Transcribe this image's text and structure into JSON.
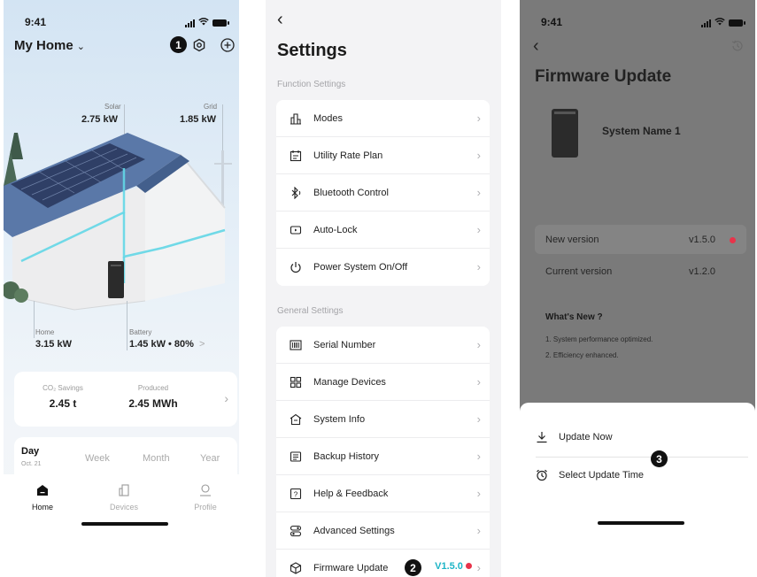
{
  "status_time": "9:41",
  "home": {
    "title": "My Home",
    "badge": "1",
    "solar": {
      "label": "Solar",
      "value": "2.75 kW"
    },
    "grid": {
      "label": "Grid",
      "value": "1.85 kW"
    },
    "home_power": {
      "label": "Home",
      "value": "3.15 kW"
    },
    "battery": {
      "label": "Battery",
      "value": "1.45 kW • 80%",
      "arrow": ">"
    },
    "stats": {
      "co2_label": "CO₂ Savings",
      "co2_value": "2.45 t",
      "produced_label": "Produced",
      "produced_value": "2.45 MWh"
    },
    "periods": [
      "Day",
      "Week",
      "Month",
      "Year"
    ],
    "period_date": "Oct. 21",
    "tabbar": {
      "home": "Home",
      "devices": "Devices",
      "profile": "Profile"
    }
  },
  "settings": {
    "title": "Settings",
    "function_section": "Function Settings",
    "function_items": [
      "Modes",
      "Utility Rate Plan",
      "Bluetooth Control",
      "Auto-Lock",
      "Power System On/Off"
    ],
    "general_section": "General Settings",
    "general_items": [
      "Serial Number",
      "Manage Devices",
      "System Info",
      "Backup History",
      "Help & Feedback",
      "Advanced Settings",
      "Firmware Update"
    ],
    "firmware_version": "V1.5.0",
    "badge": "2"
  },
  "firmware": {
    "title": "Firmware Update",
    "system_name": "System Name 1",
    "new_version_label": "New version",
    "new_version_value": "v1.5.0",
    "current_version_label": "Current version",
    "current_version_value": "v1.2.0",
    "whats_new": "What's New ?",
    "notes": [
      "1. System performance optimized.",
      "2. Efficiency enhanced."
    ],
    "update_now": "Update Now",
    "select_time": "Select Update Time",
    "badge": "3"
  },
  "colors": {
    "accent": "#1cb4c6",
    "alert": "#e8334a",
    "dark": "#111111"
  }
}
